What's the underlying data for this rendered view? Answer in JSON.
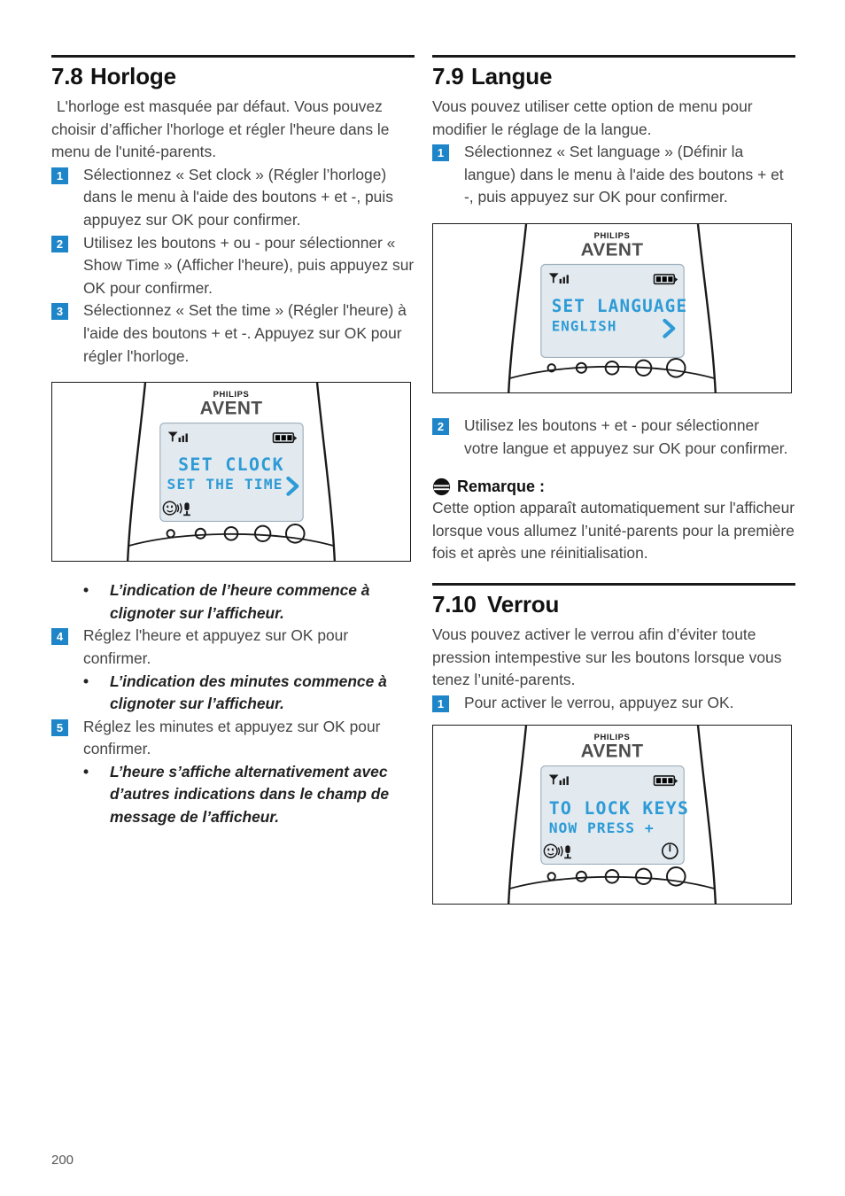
{
  "page": {
    "number": "200"
  },
  "left_column": {
    "section": {
      "number": "7.8",
      "title": "Horloge"
    },
    "intro": "L'horloge est masquée par défaut. Vous pouvez choisir d’afficher l'horloge et régler l'heure dans le menu de l'unité-parents.",
    "steps": [
      {
        "num": "1",
        "text": "Sélectionnez « Set clock » (Régler l’horloge) dans le menu à l'aide des boutons + et -, puis appuyez sur OK pour confirmer."
      },
      {
        "num": "2",
        "text": "Utilisez les boutons + ou - pour sélectionner « Show Time » (Afficher l'heure), puis appuyez sur OK pour confirmer."
      },
      {
        "num": "3",
        "text": "Sélectionnez « Set the time » (Régler l'heure) à l'aide des boutons + et -. Appuyez sur OK pour régler l'horloge."
      }
    ],
    "bullet_after_figure": "L’indication de l’heure commence à clignoter sur l’afficheur.",
    "step4": {
      "num": "4",
      "text": "Réglez l'heure et appuyez sur OK pour confirmer."
    },
    "bullet_after_step4": "L’indication des minutes commence à clignoter sur l’afficheur.",
    "step5": {
      "num": "5",
      "text": "Réglez les minutes et appuyez sur OK pour confirmer."
    },
    "bullet_after_step5": "L’heure s’affiche alternativement avec d’autres indications dans le champ de message de l’afficheur.",
    "device": {
      "brand_top": "PHILIPS",
      "brand_bottom": "AVENT",
      "lcd_line1": "SET CLOCK",
      "lcd_line2": "SET THE TIME",
      "icons": {
        "signal": "signal-bars-icon",
        "battery": "battery-full-icon",
        "smiley": "smiley-icon",
        "microphone": "microphone-icon",
        "chevron": "chevron-right-icon"
      },
      "has_power_icon": false,
      "has_status_icons": true
    }
  },
  "right_column": {
    "section_language": {
      "number": "7.9",
      "title": "Langue",
      "intro": "Vous pouvez utiliser cette option de menu pour modifier le réglage de la langue.",
      "step1": {
        "num": "1",
        "text": "Sélectionnez « Set language » (Définir la langue) dans le menu à l'aide des boutons + et -, puis appuyez sur OK pour confirmer."
      },
      "step2": {
        "num": "2",
        "text": "Utilisez les boutons + et - pour sélectionner votre langue et appuyez sur OK pour confirmer."
      },
      "device": {
        "brand_top": "PHILIPS",
        "brand_bottom": "AVENT",
        "lcd_line1": "SET LANGUAGE",
        "lcd_line2": "ENGLISH",
        "has_power_icon": false,
        "has_status_icons": false
      }
    },
    "note": {
      "icon": "note-info-icon",
      "title": "Remarque :",
      "text": "Cette option apparaît automatiquement sur l'afficheur lorsque vous allumez l’unité-parents pour la première fois et après une réinitialisation."
    },
    "section_lock": {
      "number": "7.10",
      "title": "Verrou",
      "intro": "Vous pouvez activer le verrou afin d’éviter toute pression intempestive sur les boutons lorsque vous tenez l’unité-parents.",
      "step1": {
        "num": "1",
        "text": "Pour activer le verrou, appuyez sur OK."
      },
      "device": {
        "brand_top": "PHILIPS",
        "brand_bottom": "AVENT",
        "lcd_line1": "TO LOCK KEYS",
        "lcd_line2": "NOW PRESS  +",
        "has_power_icon": true,
        "has_status_icons": true
      }
    }
  },
  "colors": {
    "badge_blue": "#1E86C8",
    "lcd_text_blue": "#2E9BD6",
    "lcd_background": "#E2EAF0",
    "rule_black": "#1a1a1a",
    "body_text": "#444444"
  }
}
